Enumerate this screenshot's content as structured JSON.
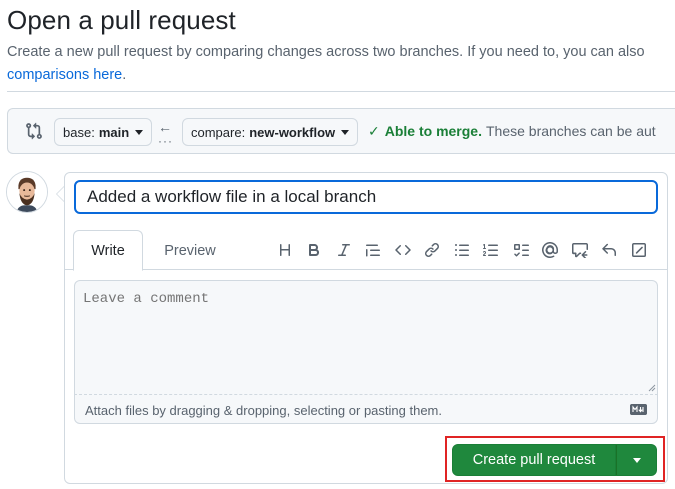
{
  "header": {
    "title": "Open a pull request",
    "subtitle": "Create a new pull request by comparing changes across two branches. If you need to, you can also",
    "link": "comparisons here",
    "link_suffix": "."
  },
  "compare": {
    "base_label": "base:",
    "base_value": "main",
    "compare_label": "compare:",
    "compare_value": "new-workflow",
    "merge_status": "Able to merge.",
    "merge_detail": "These branches can be aut"
  },
  "form": {
    "title_value": "Added a workflow file in a local branch",
    "tabs": [
      {
        "label": "Write",
        "active": true
      },
      {
        "label": "Preview",
        "active": false
      }
    ],
    "toolbar_icons": [
      "heading-icon",
      "bold-icon",
      "italic-icon",
      "quote-icon",
      "code-icon",
      "link-icon",
      "unordered-list-icon",
      "ordered-list-icon",
      "task-list-icon",
      "mention-icon",
      "reference-icon",
      "undo-icon",
      "expand-icon"
    ],
    "comment_placeholder": "Leave a comment",
    "attach_hint": "Attach files by dragging & dropping, selecting or pasting them."
  },
  "actions": {
    "create_label": "Create pull request"
  },
  "colors": {
    "accent": "#0969da",
    "success": "#1a7f37",
    "primary_button": "#1f883d",
    "highlight": "#e02424"
  }
}
